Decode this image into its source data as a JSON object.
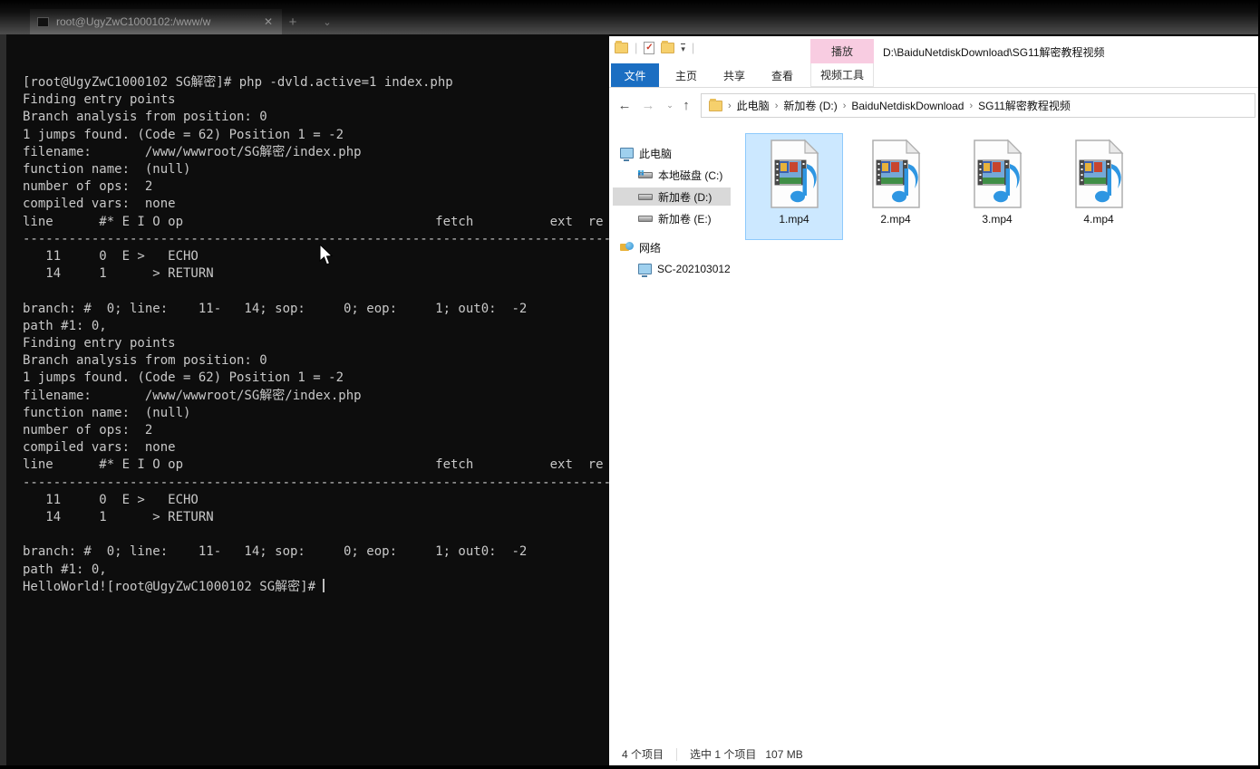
{
  "terminal": {
    "tab_title": "root@UgyZwC1000102:/www/w",
    "close_icon": "✕",
    "new_tab_icon": "+",
    "dropdown_icon": "⌄",
    "body": "[root@UgyZwC1000102 SG解密]# php -dvld.active=1 index.php\nFinding entry points\nBranch analysis from position: 0\n1 jumps found. (Code = 62) Position 1 = -2\nfilename:       /www/wwwroot/SG解密/index.php\nfunction name:  (null)\nnumber of ops:  2\ncompiled vars:  none\nline      #* E I O op                                 fetch          ext  re\n------------------------------------------------------------------------------\n   11     0  E >   ECHO\n   14     1      > RETURN\n\nbranch: #  0; line:    11-   14; sop:     0; eop:     1; out0:  -2\npath #1: 0,\nFinding entry points\nBranch analysis from position: 0\n1 jumps found. (Code = 62) Position 1 = -2\nfilename:       /www/wwwroot/SG解密/index.php\nfunction name:  (null)\nnumber of ops:  2\ncompiled vars:  none\nline      #* E I O op                                 fetch          ext  re\n------------------------------------------------------------------------------\n   11     0  E >   ECHO\n   14     1      > RETURN\n\nbranch: #  0; line:    11-   14; sop:     0; eop:     1; out0:  -2\npath #1: 0,\n",
    "last_line": "HelloWorld![root@UgyZwC1000102 SG解密]# "
  },
  "explorer": {
    "window_title": "D:\\BaiduNetdiskDownload\\SG11解密教程视频",
    "play_tab_label": "播放",
    "qat": {
      "sep": "|",
      "dropdown": "▾",
      "check_glyph": "✓"
    },
    "menu_tabs": [
      {
        "label": "文件",
        "active": true
      },
      {
        "label": "主页",
        "active": false
      },
      {
        "label": "共享",
        "active": false
      },
      {
        "label": "查看",
        "active": false
      },
      {
        "label": "视频工具",
        "active": false
      }
    ],
    "nav_arrows": {
      "back": "←",
      "forward": "→",
      "recent": "⌄",
      "up": "↑"
    },
    "breadcrumb_sep": "›",
    "breadcrumb": [
      "此电脑",
      "新加卷 (D:)",
      "BaiduNetdiskDownload",
      "SG11解密教程视频"
    ],
    "sidebar": {
      "items": [
        {
          "label": "此电脑",
          "icon": "computer-icon",
          "selected": false
        },
        {
          "label": "本地磁盘 (C:)",
          "icon": "drive-windows-icon",
          "selected": false
        },
        {
          "label": "新加卷 (D:)",
          "icon": "drive-icon",
          "selected": true
        },
        {
          "label": "新加卷 (E:)",
          "icon": "drive-icon",
          "selected": false
        },
        {
          "label": "网络",
          "icon": "network-icon",
          "selected": false
        },
        {
          "label": "SC-202103012",
          "icon": "computer-icon",
          "selected": false
        }
      ]
    },
    "files": [
      {
        "name": "1.mp4",
        "selected": true
      },
      {
        "name": "2.mp4",
        "selected": false
      },
      {
        "name": "3.mp4",
        "selected": false
      },
      {
        "name": "4.mp4",
        "selected": false
      }
    ],
    "status": {
      "items_count": "4 个项目",
      "selection": "选中 1 个项目",
      "size": "107 MB"
    }
  }
}
